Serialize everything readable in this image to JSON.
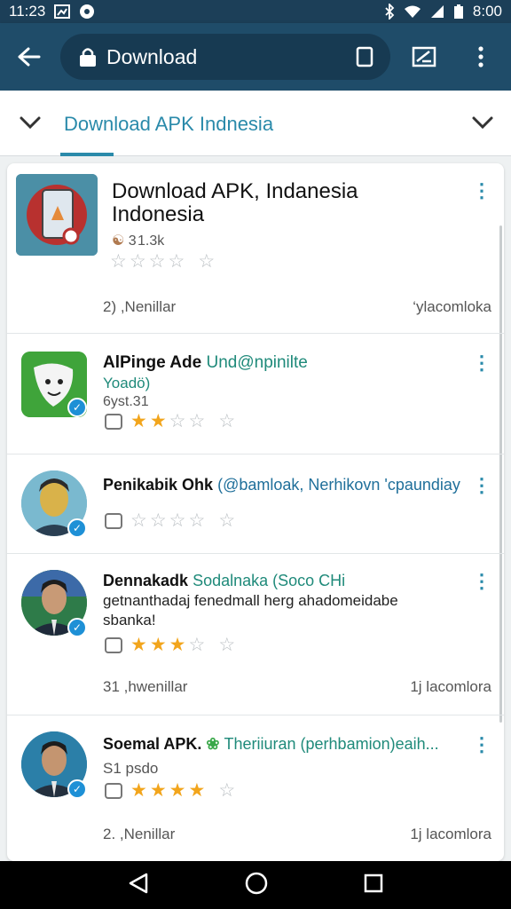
{
  "status_bar": {
    "time_left": "11:23",
    "time_right": "8:00"
  },
  "toolbar": {
    "url": "Download"
  },
  "tabbar": {
    "title": "Download APK Indnesia"
  },
  "items": [
    {
      "title": "Download APK, Indanesia",
      "title_line2": "Indonesia",
      "meta": "3 1.3k",
      "rating": 0,
      "footer_left": "2) ,Nenillar",
      "footer_right": "‘ylacomloka"
    },
    {
      "title": "AlPinge Ade",
      "source": "Und@npinilte",
      "sub": "Yoadö)",
      "meta": "6yst.31",
      "rating": 2
    },
    {
      "title": "Penikabik Ohk",
      "source": "(@bamloak, Nerhikovn 'cpaundiay",
      "rating": 0
    },
    {
      "title": "Dennakadk",
      "source": "Sodalnaka (Soco CHi",
      "sub": "getnanthadaj fenedmall herg ahadomeidabe",
      "sub2": "sbanka!",
      "rating": 2.5,
      "footer_left": "31 ,hwenillar",
      "footer_right": "1j lacomlora"
    },
    {
      "title": "Soemal APK.",
      "source": "Theriiuran (perhbamion)eaih...",
      "meta": "S1 psdo",
      "rating": 4,
      "footer_left": "2. ,Nenillar",
      "footer_right": "1j lacomlora"
    }
  ]
}
